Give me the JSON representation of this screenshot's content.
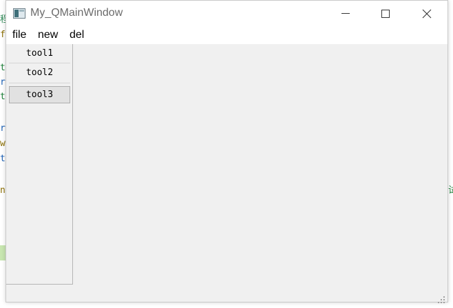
{
  "window": {
    "title": "My_QMainWindow",
    "controls": {
      "minimize": "minimize",
      "maximize": "maximize",
      "close": "close"
    }
  },
  "menubar": {
    "items": [
      {
        "label": "file"
      },
      {
        "label": "new"
      },
      {
        "label": "del"
      }
    ]
  },
  "toolbar": {
    "items": [
      {
        "label": "tool1"
      },
      {
        "label": "tool2"
      },
      {
        "label": "tool3",
        "active": true
      }
    ]
  },
  "background_fragments": [
    "程",
    "f",
    "t",
    "r",
    "t",
    "r",
    "w",
    "t",
    "n",
    "试"
  ],
  "colors": {
    "window_bg": "#f0f0f0",
    "titlebar_bg": "#ffffff",
    "title_text": "#6b6b6b",
    "tool_active_bg": "#e1e1e1"
  }
}
